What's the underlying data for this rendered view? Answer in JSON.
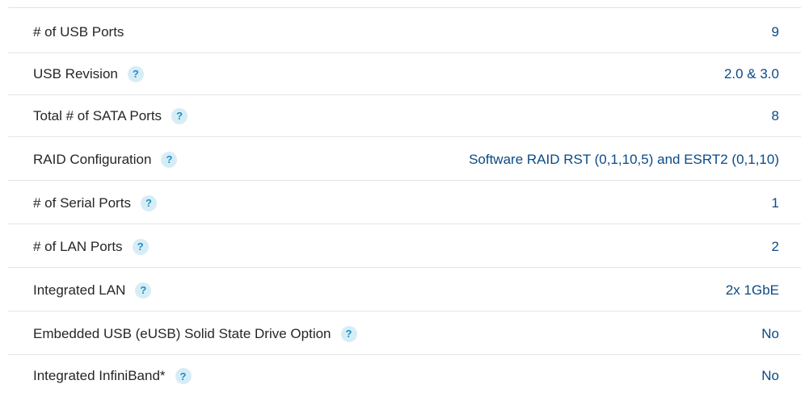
{
  "specs": {
    "rows": [
      {
        "label": "# of USB Ports",
        "value": "9",
        "help": false
      },
      {
        "label": "USB Revision",
        "value": "2.0 & 3.0",
        "help": true
      },
      {
        "label": "Total # of SATA Ports",
        "value": "8",
        "help": true
      },
      {
        "label": "RAID Configuration",
        "value": "Software RAID RST (0,1,10,5) and ESRT2 (0,1,10)",
        "help": true
      },
      {
        "label": "# of Serial Ports",
        "value": "1",
        "help": true
      },
      {
        "label": "# of LAN Ports",
        "value": "2",
        "help": true
      },
      {
        "label": "Integrated LAN",
        "value": "2x 1GbE",
        "help": true
      },
      {
        "label": "Embedded USB (eUSB) Solid State Drive Option",
        "value": "No",
        "help": true
      },
      {
        "label": "Integrated InfiniBand*",
        "value": "No",
        "help": true
      }
    ],
    "help_glyph": "?"
  },
  "colors": {
    "label": "#262626",
    "value": "#0b4a85",
    "help_icon_bg": "#d7edf6",
    "help_icon_fg": "#1e8fc6",
    "divider": "#e4e4e4"
  }
}
